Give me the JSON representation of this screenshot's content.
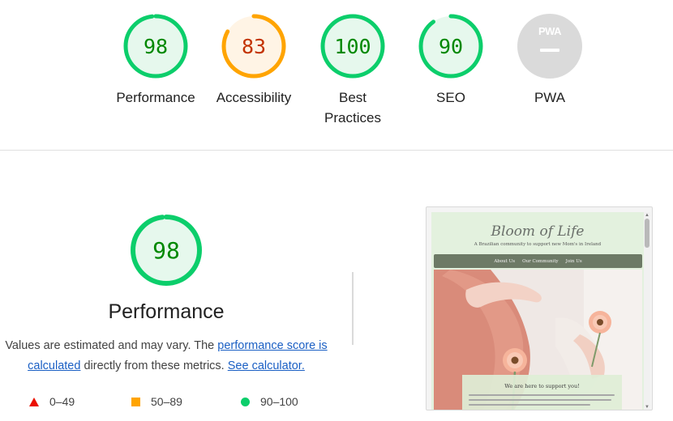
{
  "categories": [
    {
      "label": "Performance",
      "score": "98",
      "value": 98,
      "color": "#0cce6b",
      "text_color": "#008800",
      "fill": "#e6f8ed"
    },
    {
      "label": "Accessibility",
      "score": "83",
      "value": 83,
      "color": "#ffa400",
      "text_color": "#c33300",
      "fill": "#fff4e5"
    },
    {
      "label": "Best Practices",
      "score": "100",
      "value": 100,
      "color": "#0cce6b",
      "text_color": "#008800",
      "fill": "#e6f8ed"
    },
    {
      "label": "SEO",
      "score": "90",
      "value": 90,
      "color": "#0cce6b",
      "text_color": "#008800",
      "fill": "#e6f8ed"
    }
  ],
  "pwa": {
    "label": "PWA",
    "badge_text": "PWA",
    "color": "#dadada"
  },
  "performance": {
    "title": "Performance",
    "score": "98",
    "value": 98,
    "desc_before": "Values are estimated and may vary. The ",
    "link_score": "performance score is calculated",
    "desc_middle": " directly from these metrics. ",
    "link_calc": "See calculator."
  },
  "legend": [
    {
      "range": "0–49",
      "shape": "triangle",
      "color": "#eb0f00"
    },
    {
      "range": "50–89",
      "shape": "square",
      "color": "#ffa400"
    },
    {
      "range": "90–100",
      "shape": "circle",
      "color": "#0cce6b"
    }
  ],
  "screenshot": {
    "logo": "Bloom of Life",
    "tagline": "A Brazilian community to support new Mom's in Ireland",
    "nav": [
      "About Us",
      "Our Community",
      "Join Us"
    ],
    "support_title": "We are here to support you!"
  }
}
